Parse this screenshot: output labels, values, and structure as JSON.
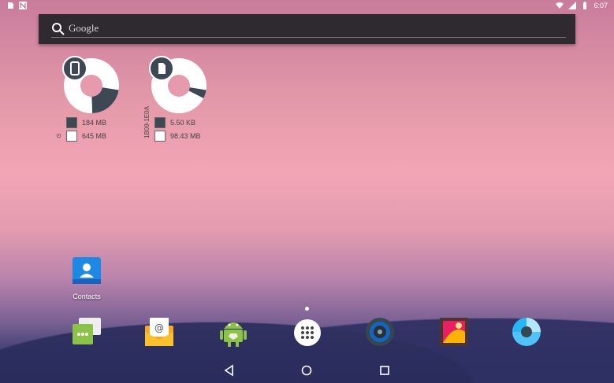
{
  "status_bar": {
    "left_icons": [
      "sd-card-icon",
      "notification-n-icon"
    ],
    "right_icons": [
      "wifi-icon",
      "signal-icon",
      "battery-icon"
    ],
    "time": "6:07"
  },
  "search": {
    "label": "Google",
    "icon": "search-icon"
  },
  "widgets": [
    {
      "name": "internal-storage",
      "badge_icon": "phone-icon",
      "used_fraction": 0.22,
      "legend": [
        {
          "label": "184 MB",
          "color": "#3e4754"
        },
        {
          "label": "645 MB",
          "color": "#ffffff"
        }
      ],
      "side_label": "⊙"
    },
    {
      "name": "sd-storage",
      "badge_icon": "sd-card-icon",
      "used_fraction": 0.05,
      "legend": [
        {
          "label": "5.50 KB",
          "color": "#3e4754"
        },
        {
          "label": "98.43 MB",
          "color": "#ffffff"
        }
      ],
      "side_label": "1B09-1E0A"
    }
  ],
  "desktop": {
    "contacts_label": "Contacts"
  },
  "dock": [
    {
      "name": "messaging",
      "icon": "messaging-icon"
    },
    {
      "name": "email",
      "icon": "email-icon"
    },
    {
      "name": "android-apk",
      "icon": "android-icon"
    },
    {
      "name": "app-drawer",
      "icon": "app-drawer-icon"
    },
    {
      "name": "music",
      "icon": "speaker-icon"
    },
    {
      "name": "gallery",
      "icon": "gallery-icon"
    },
    {
      "name": "camera",
      "icon": "camera-icon"
    }
  ],
  "nav": {
    "back": "back-icon",
    "home": "home-icon",
    "recents": "recents-icon"
  },
  "colors": {
    "widget_dark": "#3e4754",
    "search_bg": "#2f2a2f"
  }
}
